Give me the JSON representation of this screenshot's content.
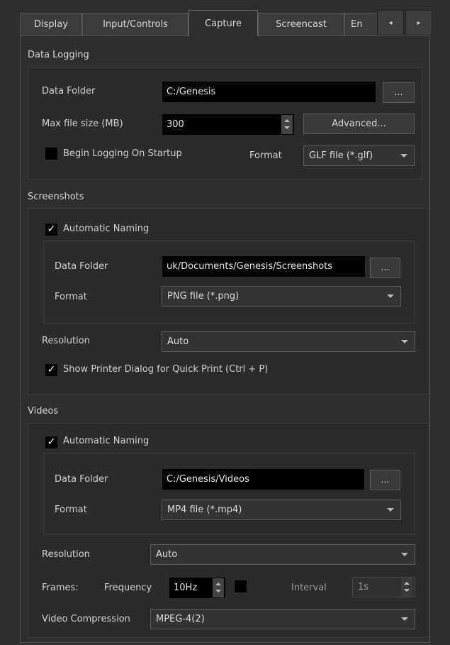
{
  "tabs": [
    {
      "label": "Display"
    },
    {
      "label": "Input/Controls"
    },
    {
      "label": "Capture"
    },
    {
      "label": "Screencast"
    },
    {
      "label": "En"
    }
  ],
  "tab_scroll": {
    "left_icon": "arrow-left-icon",
    "right_icon": "arrow-right-icon",
    "left": "◂",
    "right": "▸"
  },
  "data_logging": {
    "title": "Data Logging",
    "data_folder_label": "Data Folder",
    "data_folder_value": "C:/Genesis",
    "browse_label": "...",
    "max_size_label": "Max file size (MB)",
    "max_size_value": "300",
    "advanced_label": "Advanced...",
    "begin_logging_label": "Begin Logging On Startup",
    "begin_logging_checked": false,
    "format_label": "Format",
    "format_value": "GLF file (*.glf)"
  },
  "screenshots": {
    "title": "Screenshots",
    "auto_naming_label": "Automatic Naming",
    "auto_naming_checked": true,
    "data_folder_label": "Data Folder",
    "data_folder_value": "uk/Documents/Genesis/Screenshots",
    "browse_label": "...",
    "format_label": "Format",
    "format_value": "PNG file (*.png)",
    "resolution_label": "Resolution",
    "resolution_value": "Auto",
    "printer_dialog_label": "Show Printer Dialog for Quick Print (Ctrl + P)",
    "printer_dialog_checked": true
  },
  "videos": {
    "title": "Videos",
    "auto_naming_label": "Automatic Naming",
    "auto_naming_checked": true,
    "data_folder_label": "Data Folder",
    "data_folder_value": "C:/Genesis/Videos",
    "browse_label": "...",
    "format_label": "Format",
    "format_value": "MP4 file (*.mp4)",
    "resolution_label": "Resolution",
    "resolution_value": "Auto",
    "frames_label": "Frames:",
    "frequency_label": "Frequency",
    "frequency_value": "10Hz",
    "interval_checked": false,
    "interval_label": "Interval",
    "interval_value": "1s",
    "compression_label": "Video Compression",
    "compression_value": "MPEG-4(2)"
  },
  "check_mark": "✓"
}
